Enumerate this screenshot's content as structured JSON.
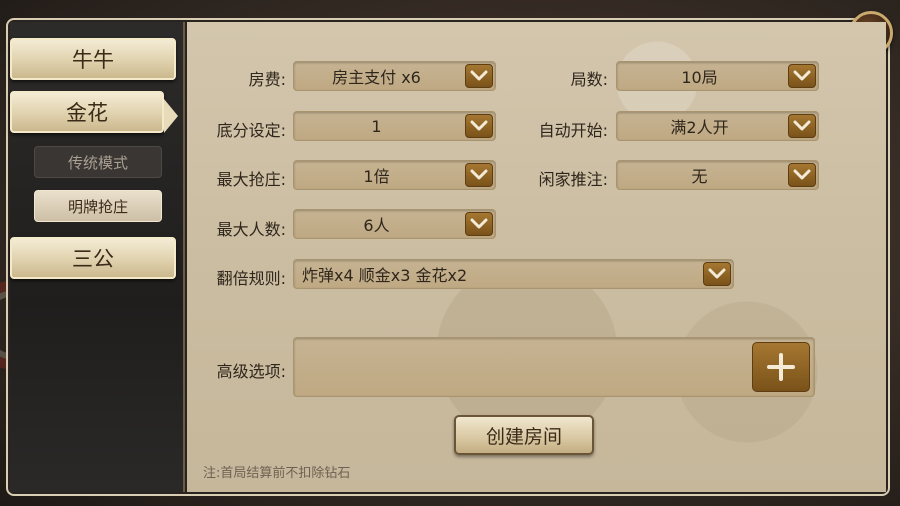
{
  "sidebar": {
    "tabs": [
      {
        "label": "牛牛"
      },
      {
        "label": "金花"
      },
      {
        "label": "三公"
      }
    ],
    "subtabs": [
      {
        "label": "传统模式"
      },
      {
        "label": "明牌抢庄"
      }
    ]
  },
  "form": {
    "room_fee": {
      "label": "房费:",
      "value": "房主支付 x6"
    },
    "rounds": {
      "label": "局数:",
      "value": "10局"
    },
    "base_score": {
      "label": "底分设定:",
      "value": "1"
    },
    "auto_start": {
      "label": "自动开始:",
      "value": "满2人开"
    },
    "max_grab": {
      "label": "最大抢庄:",
      "value": "1倍"
    },
    "idle_bet": {
      "label": "闲家推注:",
      "value": "无"
    },
    "max_players": {
      "label": "最大人数:",
      "value": "6人"
    },
    "double_rule": {
      "label": "翻倍规则:",
      "value": "炸弹x4 顺金x3 金花x2"
    },
    "advanced": {
      "label": "高级选项:"
    }
  },
  "actions": {
    "create_room": "创建房间"
  },
  "note": "注:首局结算前不扣除钻石",
  "icons": {
    "dropdown": "chevron-down-icon",
    "plus": "plus-icon",
    "close": "close-icon"
  },
  "colors": {
    "accent_brown": "#8d6323",
    "panel_beige": "#cfc1a6",
    "sidebar_dark": "#232221"
  }
}
